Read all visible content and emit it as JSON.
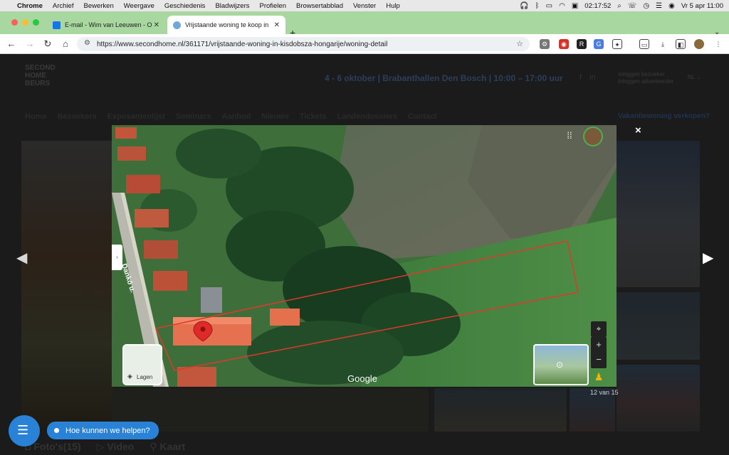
{
  "menubar": {
    "app": "Chrome",
    "items": [
      "Archief",
      "Bewerken",
      "Weergave",
      "Geschiedenis",
      "Bladwijzers",
      "Profielen",
      "Browsertabblad",
      "Venster",
      "Hulp"
    ],
    "timer": "02:17:52",
    "datetime": "Vr 5 apr  11:00"
  },
  "tabs": [
    {
      "title": "E-mail - Wim van Leeuwen - O",
      "active": false
    },
    {
      "title": "Vrijstaande woning te koop in",
      "active": true
    }
  ],
  "toolbar": {
    "url": "https://www.secondhome.nl/361171/vrijstaande-woning-in-kisdobsza-hongarije/woning-detail",
    "new_tab": "+"
  },
  "site": {
    "logo_lines": [
      "SECOND",
      "HOME",
      "BEURS"
    ],
    "event": "4 - 6 oktober | Brabanthallen Den Bosch | 10:00 – 17:00 uur",
    "login_visitor": "Inloggen bezoeker",
    "login_advertiser": "Inloggen adverteerder",
    "language": "NL ⌄",
    "nav": [
      "Home",
      "Bezoekers",
      "Exposantenlijst",
      "Seminars",
      "Aanbod",
      "Nieuws",
      "Tickets",
      "Landendossiers",
      "Contact"
    ],
    "sell_link": "Vakantiewoning verkopen?",
    "bottom_tabs": [
      "Foto's(15)",
      "Video",
      "Kaart"
    ]
  },
  "map": {
    "street_label": "Dankó u.",
    "google_label": "Google",
    "layers_label": "Lagen"
  },
  "lightbox": {
    "counter": "12 van 15",
    "close": "×"
  },
  "chat": {
    "prompt": "Hoe kunnen we helpen?"
  },
  "colors": {
    "tabbar": "#a8d8a0",
    "parcel_outline": "#e0392b",
    "marker": "#e02a2a",
    "chat_blue": "#2a82d6"
  }
}
